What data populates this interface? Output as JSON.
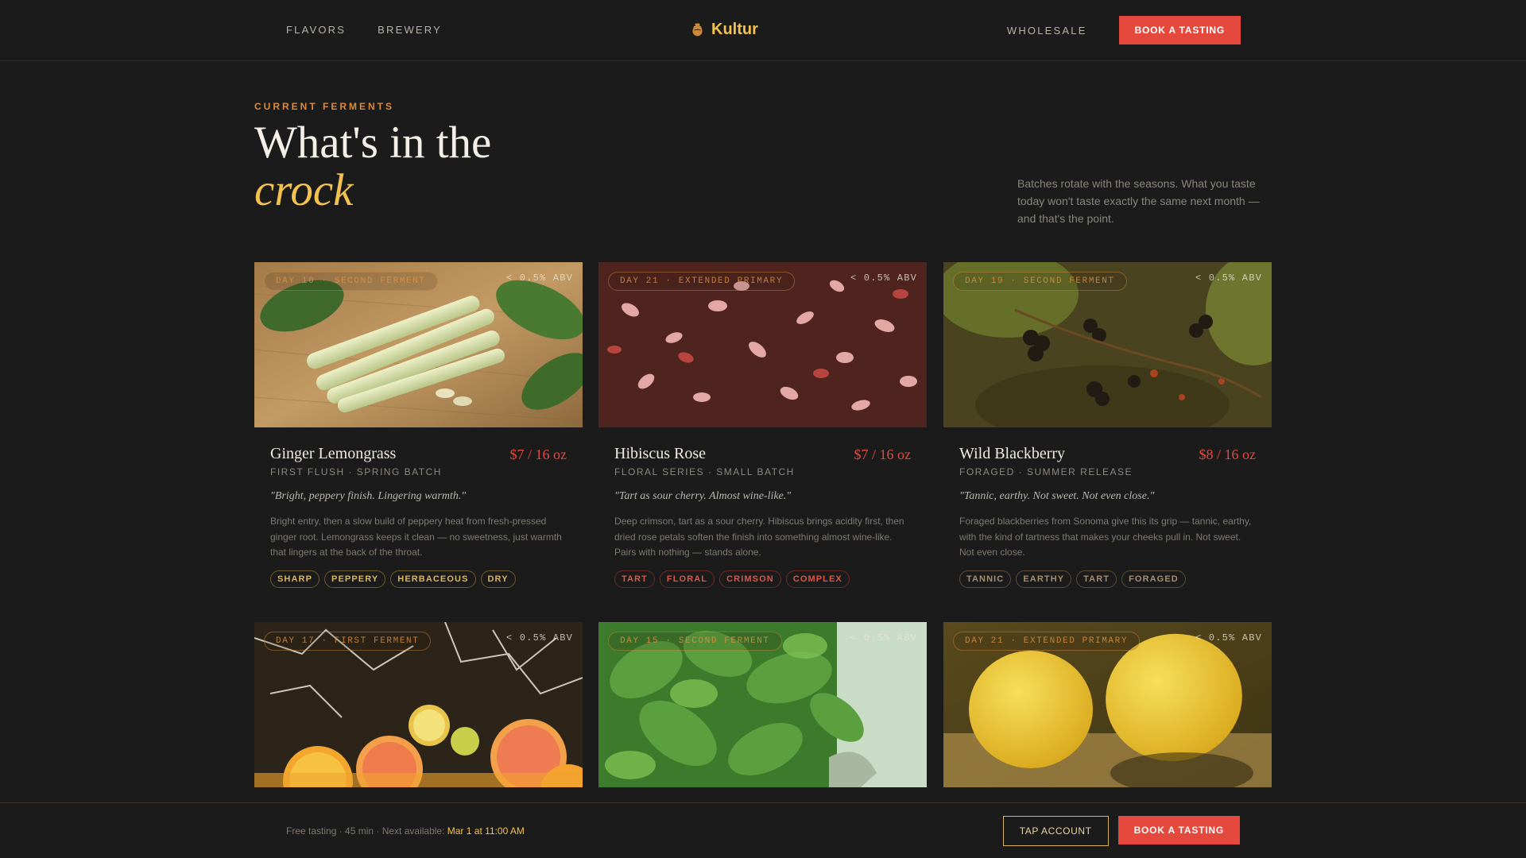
{
  "nav": {
    "left_links": [
      "FLAVORS",
      "BREWERY"
    ],
    "brand": "Kultur",
    "brand_icon": "jar-icon",
    "wholesale": "WHOLESALE",
    "cta": "BOOK A TASTING"
  },
  "hero": {
    "eyebrow": "CURRENT FERMENTS",
    "title_line1": "What's in the",
    "title_line2": "crock",
    "aside": "Batches rotate with the seasons. What you taste today won't taste exactly the same next month — and that's the point."
  },
  "cards": [
    {
      "stage": "DAY 10 · SECOND FERMENT",
      "abv": "< 0.5% ABV",
      "name": "Ginger Lemongrass",
      "price": "$7 / 16 oz",
      "meta": "FIRST FLUSH · SPRING BATCH",
      "quote": "\"Bright, peppery finish. Lingering warmth.\"",
      "desc": "Bright entry, then a slow build of peppery heat from fresh-pressed ginger root. Lemongrass keeps it clean — no sweetness, just warmth that lingers at the back of the throat.",
      "tag_style": "gold",
      "tags": [
        "SHARP",
        "PEPPERY",
        "HERBACEOUS",
        "DRY"
      ]
    },
    {
      "stage": "DAY 21 · EXTENDED PRIMARY",
      "abv": "< 0.5% ABV",
      "name": "Hibiscus Rose",
      "price": "$7 / 16 oz",
      "meta": "FLORAL SERIES · SMALL BATCH",
      "quote": "\"Tart as sour cherry. Almost wine-like.\"",
      "desc": "Deep crimson, tart as a sour cherry. Hibiscus brings acidity first, then dried rose petals soften the finish into something almost wine-like. Pairs with nothing — stands alone.",
      "tag_style": "red",
      "tags": [
        "TART",
        "FLORAL",
        "CRIMSON",
        "COMPLEX"
      ]
    },
    {
      "stage": "DAY 19 · SECOND FERMENT",
      "abv": "< 0.5% ABV",
      "name": "Wild Blackberry",
      "price": "$8 / 16 oz",
      "meta": "FORAGED · SUMMER RELEASE",
      "quote": "\"Tannic, earthy. Not sweet. Not even close.\"",
      "desc": "Foraged blackberries from Sonoma give this its grip — tannic, earthy, with the kind of tartness that makes your cheeks pull in. Not sweet. Not even close.",
      "tag_style": "brown",
      "tags": [
        "TANNIC",
        "EARTHY",
        "TART",
        "FORAGED"
      ]
    },
    {
      "stage": "DAY 17 · FIRST FERMENT",
      "abv": "< 0.5% ABV"
    },
    {
      "stage": "DAY 15 · SECOND FERMENT",
      "abv": "< 0.5% ABV"
    },
    {
      "stage": "DAY 21 · EXTENDED PRIMARY",
      "abv": "< 0.5% ABV"
    }
  ],
  "bottombar": {
    "info": "Free tasting · 45 min · Next available: ",
    "next_slot": "Mar 1 at 11:00 AM",
    "tap_account": "TAP ACCOUNT",
    "cta": "BOOK A TASTING"
  },
  "colors": {
    "background": "#1b1b1b",
    "accent_gold": "#f2c14e",
    "accent_red": "#e5483c",
    "eyebrow_orange": "#d98a3a"
  }
}
